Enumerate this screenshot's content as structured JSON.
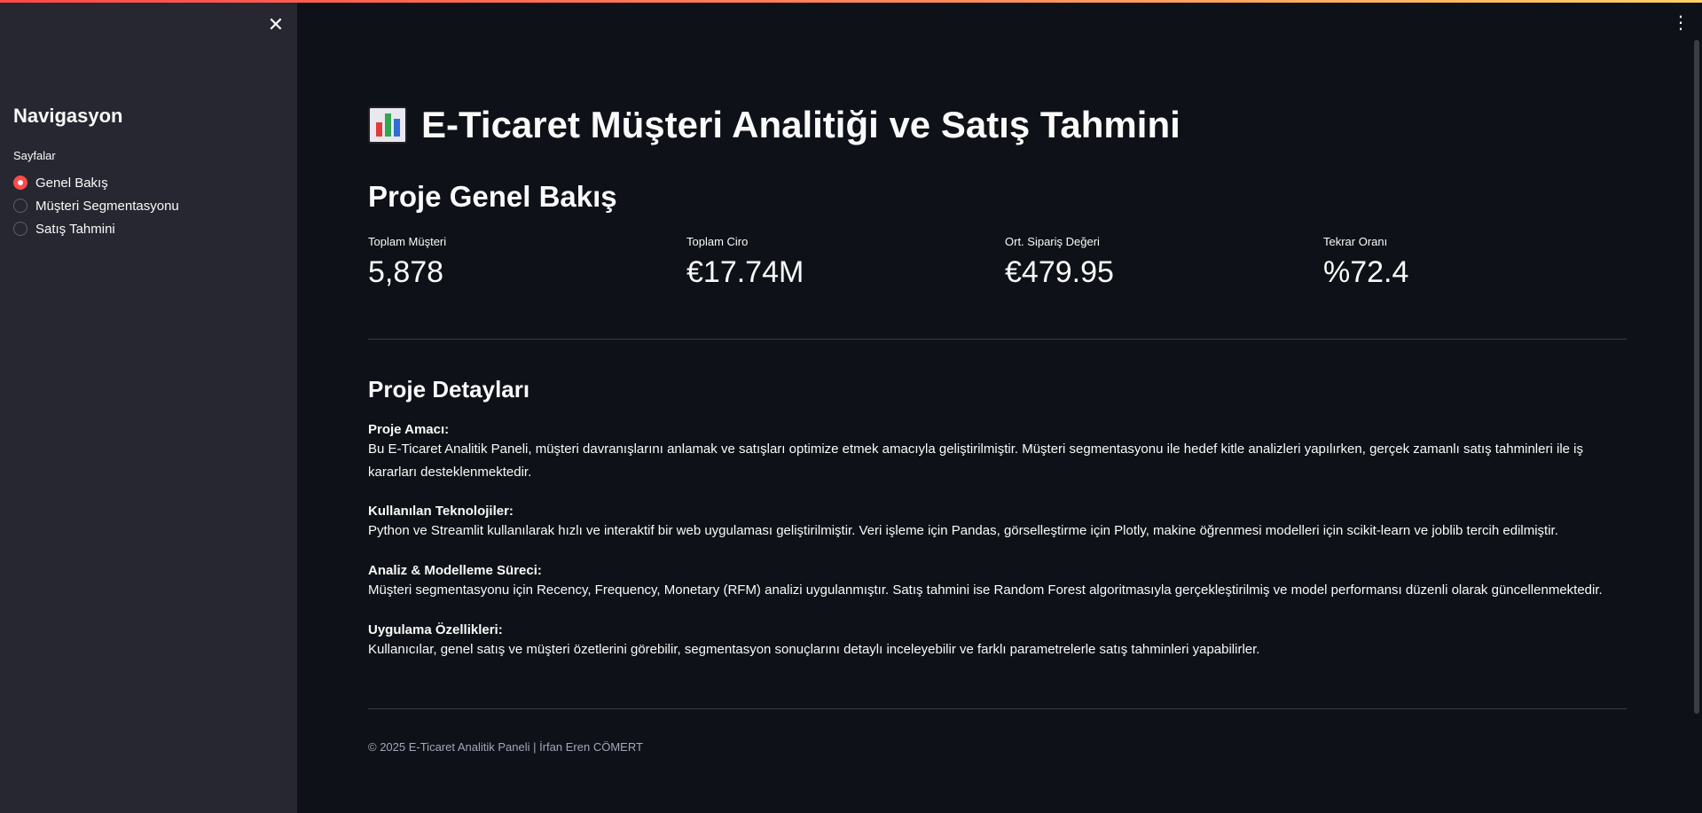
{
  "sidebar": {
    "close_icon": "close-icon",
    "title": "Navigasyon",
    "radio_label": "Sayfalar",
    "items": [
      {
        "label": "Genel Bakış",
        "selected": true
      },
      {
        "label": "Müşteri Segmentasyonu",
        "selected": false
      },
      {
        "label": "Satış Tahmini",
        "selected": false
      }
    ]
  },
  "header": {
    "menu_icon": "kebab-menu-icon"
  },
  "page": {
    "title_icon": "bar-chart-emoji-icon",
    "title": "E-Ticaret Müşteri Analitiği ve Satış Tahmini",
    "section_title": "Proje Genel Bakış",
    "metrics": [
      {
        "label": "Toplam Müşteri",
        "value": "5,878"
      },
      {
        "label": "Toplam Ciro",
        "value": "€17.74M"
      },
      {
        "label": "Ort. Sipariş Değeri",
        "value": "€479.95"
      },
      {
        "label": "Tekrar Oranı",
        "value": "%72.4"
      }
    ],
    "details_title": "Proje Detayları",
    "details": [
      {
        "heading": "Proje Amacı:",
        "text": "Bu E-Ticaret Analitik Paneli, müşteri davranışlarını anlamak ve satışları optimize etmek amacıyla geliştirilmiştir. Müşteri segmentasyonu ile hedef kitle analizleri yapılırken, gerçek zamanlı satış tahminleri ile iş kararları desteklenmektedir."
      },
      {
        "heading": "Kullanılan Teknolojiler:",
        "text": "Python ve Streamlit kullanılarak hızlı ve interaktif bir web uygulaması geliştirilmiştir. Veri işleme için Pandas, görselleştirme için Plotly, makine öğrenmesi modelleri için scikit-learn ve joblib tercih edilmiştir."
      },
      {
        "heading": "Analiz & Modelleme Süreci:",
        "text": "Müşteri segmentasyonu için Recency, Frequency, Monetary (RFM) analizi uygulanmıştır. Satış tahmini ise Random Forest algoritmasıyla gerçekleştirilmiş ve model performansı düzenli olarak güncellenmektedir."
      },
      {
        "heading": "Uygulama Özellikleri:",
        "text": "Kullanıcılar, genel satış ve müşteri özetlerini görebilir, segmentasyon sonuçlarını detaylı inceleyebilir ve farklı parametrelerle satış tahminleri yapabilirler."
      }
    ],
    "footer": "© 2025 E-Ticaret Analitik Paneli | İrfan Eren CÖMERT"
  },
  "colors": {
    "background": "#0e1117",
    "sidebar": "#262730",
    "accent": "#ff4b4b",
    "text": "#fafafa"
  }
}
